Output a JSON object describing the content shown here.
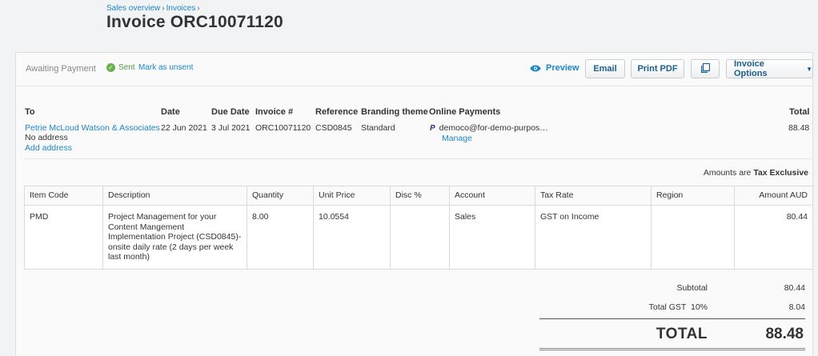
{
  "breadcrumb": [
    "Sales overview",
    "Invoices"
  ],
  "breadcrumb_sep": "›",
  "page_title": "Invoice ORC10071120",
  "actionbar": {
    "status": "Awaiting Payment",
    "sent_label": "Sent",
    "sent_icon": "check-icon",
    "mark_unsent": "Mark as unsent",
    "preview": "Preview",
    "email": "Email",
    "print_pdf": "Print PDF",
    "copy_icon": "copy-icon",
    "options": "Invoice Options",
    "options_caret": "▼"
  },
  "header": {
    "to_label": "To",
    "to_value": "Petrie McLoud Watson & Associates",
    "no_address": "No address",
    "add_address": "Add address",
    "date_label": "Date",
    "date_value": "22 Jun 2021",
    "due_label": "Due Date",
    "due_value": "3 Jul 2021",
    "invoice_label": "Invoice #",
    "invoice_value": "ORC10071120",
    "reference_label": "Reference",
    "reference_value": "CSD0845",
    "branding_label": "Branding theme",
    "branding_value": "Standard",
    "online_label": "Online Payments",
    "online_icon": "P",
    "online_value": "democo@for-demo-purpos…",
    "manage": "Manage",
    "total_label": "Total",
    "total_value": "88.48"
  },
  "amounts_are": {
    "prefix": "Amounts are",
    "value": "Tax Exclusive"
  },
  "table": {
    "columns": [
      "Item Code",
      "Description",
      "Quantity",
      "Unit Price",
      "Disc %",
      "Account",
      "Tax Rate",
      "Region",
      "Amount AUD"
    ],
    "rows": [
      {
        "item_code": "PMD",
        "description": "Project Management for your Content Mangement Implementation Project (CSD0845)- onsite daily rate (2 days per week last month)",
        "quantity": "8.00",
        "unit_price": "10.0554",
        "disc": "",
        "account": "Sales",
        "tax_rate": "GST on Income",
        "region": "",
        "amount": "80.44"
      }
    ]
  },
  "totals": {
    "subtotal_label": "Subtotal",
    "subtotal_value": "80.44",
    "gst_label": "Total GST  10%",
    "gst_value": "8.04",
    "total_label": "TOTAL",
    "total_value": "88.48"
  },
  "colors": {
    "link": "#1b87c5",
    "sent": "#4f9a3a",
    "button_text": "#1b5f8c"
  }
}
